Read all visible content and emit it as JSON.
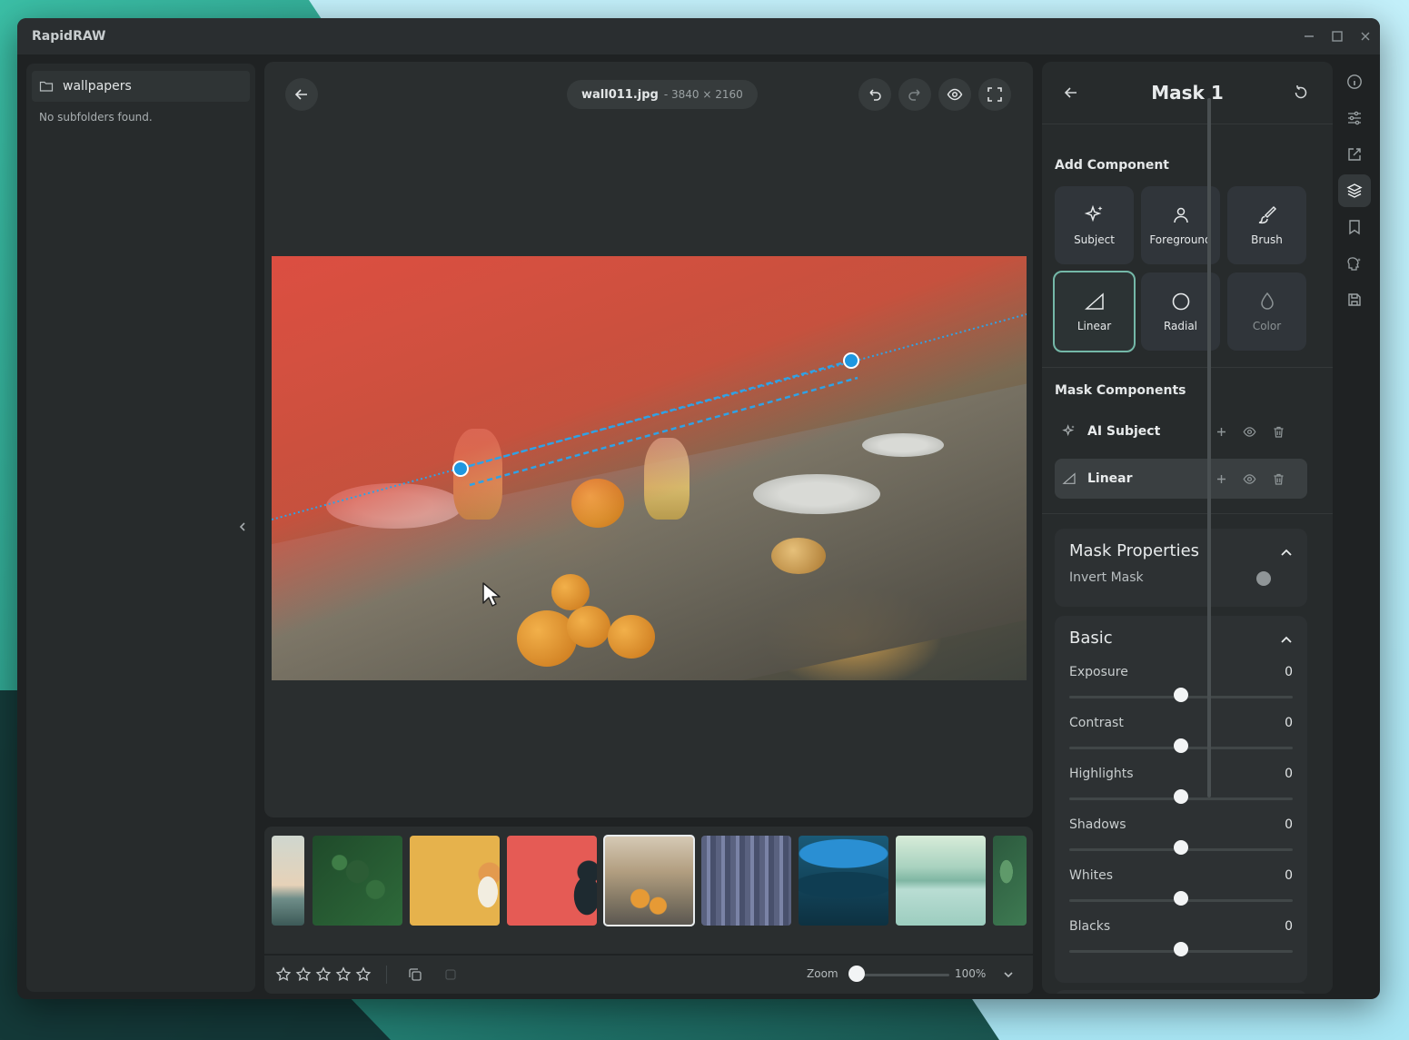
{
  "app": {
    "title": "RapidRAW"
  },
  "folder_panel": {
    "folder_name": "wallpapers",
    "empty_message": "No subfolders found."
  },
  "editor": {
    "file_name": "wall011.jpg",
    "file_dims": "- 3840 × 2160",
    "icons": [
      "arrow-left-icon",
      "undo-icon",
      "redo-icon",
      "eye-icon",
      "fullscreen-icon"
    ]
  },
  "filmstrip": {
    "thumbnails": [
      {
        "name": "dune"
      },
      {
        "name": "forest"
      },
      {
        "name": "yellow-cat"
      },
      {
        "name": "red-cat"
      },
      {
        "name": "dinner-table",
        "selected": true
      },
      {
        "name": "city"
      },
      {
        "name": "waves"
      },
      {
        "name": "mountain-lake"
      },
      {
        "name": "leaves"
      }
    ]
  },
  "bottom_bar": {
    "rating": 0,
    "rating_max": 5,
    "zoom_label": "Zoom",
    "zoom_value": "100%"
  },
  "mask_panel": {
    "title": "Mask 1",
    "add_component_heading": "Add Component",
    "components": [
      {
        "label": "Subject",
        "icon": "sparkles-icon"
      },
      {
        "label": "Foreground",
        "icon": "person-icon"
      },
      {
        "label": "Brush",
        "icon": "brush-icon"
      },
      {
        "label": "Linear",
        "icon": "linear-gradient-icon",
        "active": true
      },
      {
        "label": "Radial",
        "icon": "circle-icon"
      },
      {
        "label": "Color",
        "icon": "droplet-icon",
        "disabled": true
      }
    ],
    "mask_components_heading": "Mask Components",
    "mask_components": [
      {
        "label": "AI Subject",
        "icon": "sparkles-icon"
      },
      {
        "label": "Linear",
        "icon": "linear-gradient-icon",
        "selected": true
      }
    ],
    "mask_properties": {
      "title": "Mask Properties",
      "invert_label": "Invert Mask",
      "invert_on": false
    },
    "basic": {
      "title": "Basic",
      "sliders": [
        {
          "label": "Exposure",
          "value": "0"
        },
        {
          "label": "Contrast",
          "value": "0"
        },
        {
          "label": "Highlights",
          "value": "0"
        },
        {
          "label": "Shadows",
          "value": "0"
        },
        {
          "label": "Whites",
          "value": "0"
        },
        {
          "label": "Blacks",
          "value": "0"
        }
      ]
    }
  },
  "toolbar": {
    "tools": [
      "info-icon",
      "adjustments-icon",
      "export-icon",
      "layers-icon",
      "bookmark-icon",
      "ai-icon",
      "save-icon"
    ],
    "active": "layers-icon"
  },
  "colors": {
    "accent": "#74b8a8",
    "handle": "#1e97e0",
    "mask_overlay": "#e6463c"
  }
}
